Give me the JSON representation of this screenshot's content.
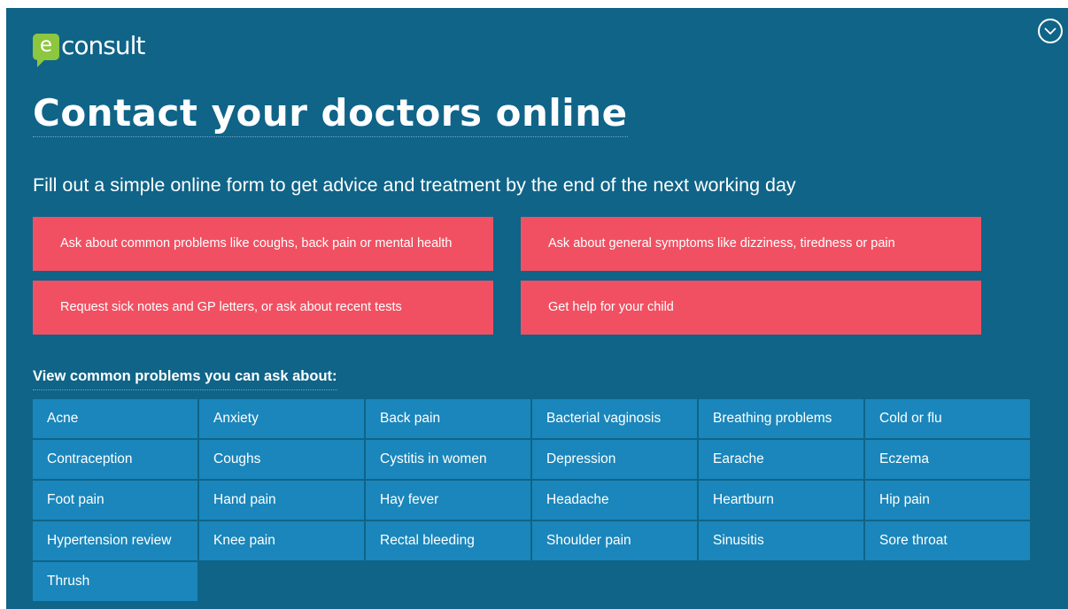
{
  "brand": {
    "logo_letter": "e",
    "logo_text": "consult",
    "accent_green": "#8dc63f",
    "background": "#0f6488",
    "cta_color": "#f15062",
    "tile_color": "#1a86bb"
  },
  "header": {
    "collapse_icon": "chevron-down-circle-icon"
  },
  "main": {
    "title": "Contact your doctors online",
    "subtitle": "Fill out a simple online form to get advice and treatment by the end of the next working day",
    "ctas": [
      {
        "label": "Ask about common problems like coughs, back pain or mental health"
      },
      {
        "label": "Ask about general symptoms like dizziness, tiredness or pain"
      },
      {
        "label": "Request sick notes and GP letters, or ask about recent tests"
      },
      {
        "label": "Get help for your child"
      }
    ],
    "problems_heading": "View common problems you can ask about:",
    "problems": [
      "Acne",
      "Anxiety",
      "Back pain",
      "Bacterial vaginosis",
      "Breathing problems",
      "Cold or flu",
      "Contraception",
      "Coughs",
      "Cystitis in women",
      "Depression",
      "Earache",
      "Eczema",
      "Foot pain",
      "Hand pain",
      "Hay fever",
      "Headache",
      "Heartburn",
      "Hip pain",
      "Hypertension review",
      "Knee pain",
      "Rectal bleeding",
      "Shoulder pain",
      "Sinusitis",
      "Sore throat",
      "Thrush"
    ]
  }
}
